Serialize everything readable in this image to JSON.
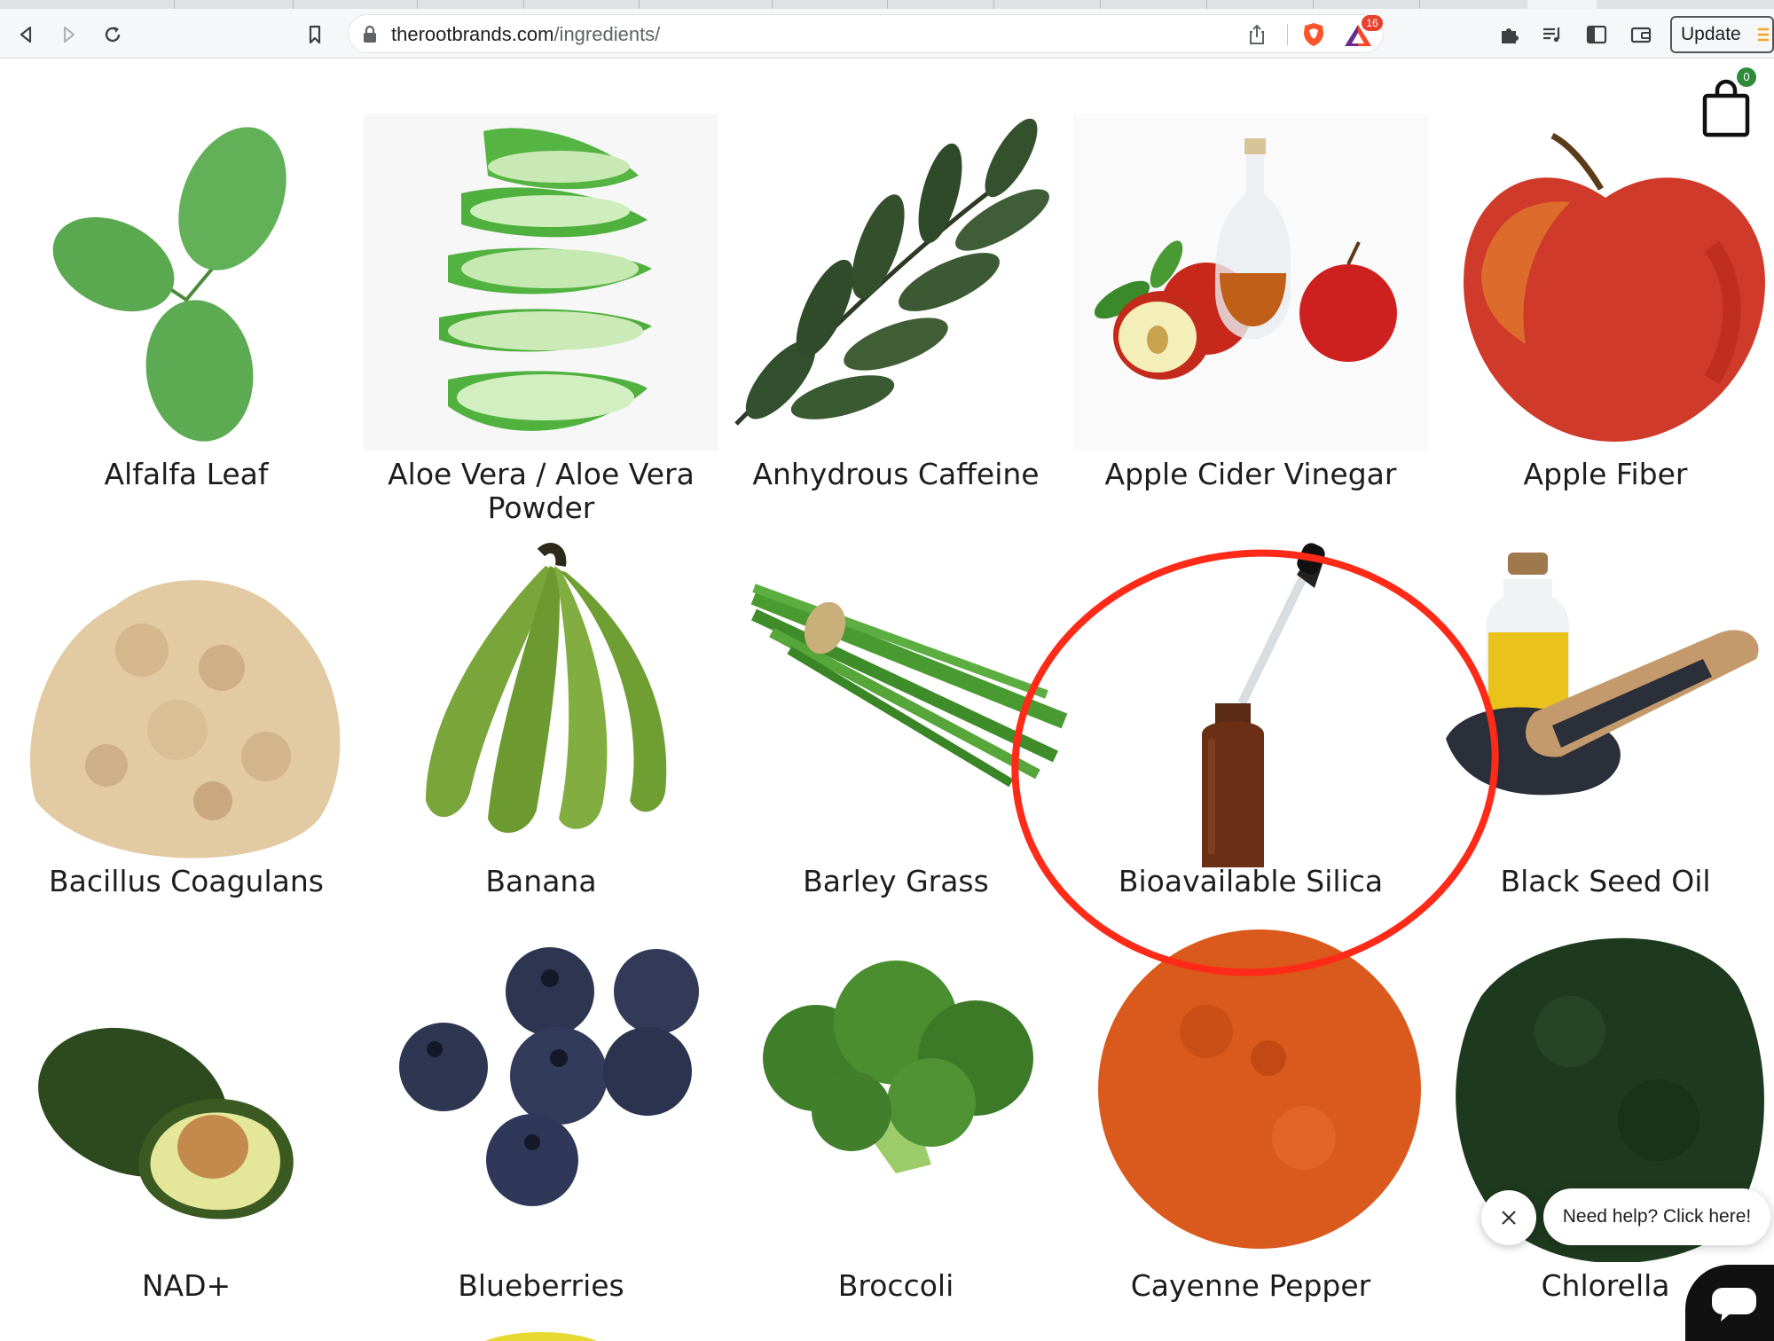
{
  "browser": {
    "url_host": "therootbrands.com",
    "url_path": "/ingredients/",
    "rewards_badge": "16",
    "update_label": "Update"
  },
  "cart": {
    "count": "0"
  },
  "ingredients": [
    {
      "label": "Alfalfa Leaf",
      "icon": "alfalfa-leaf-image"
    },
    {
      "label": "Aloe Vera / Aloe Vera",
      "label2": "Powder",
      "icon": "aloe-vera-image"
    },
    {
      "label": "Anhydrous Caffeine",
      "icon": "caffeine-leaves-image"
    },
    {
      "label": "Apple Cider Vinegar",
      "icon": "apple-cider-vinegar-image"
    },
    {
      "label": "Apple Fiber",
      "icon": "apple-image"
    },
    {
      "label": "Bacillus Coagulans",
      "icon": "powder-image"
    },
    {
      "label": "Banana",
      "icon": "banana-image"
    },
    {
      "label": "Barley Grass",
      "icon": "barley-grass-image"
    },
    {
      "label": "Bioavailable Silica",
      "icon": "dropper-bottle-image"
    },
    {
      "label": "Black Seed Oil",
      "icon": "black-seed-oil-image"
    },
    {
      "label": "NAD+",
      "icon": "avocado-image"
    },
    {
      "label": "Blueberries",
      "icon": "blueberries-image"
    },
    {
      "label": "Broccoli",
      "icon": "broccoli-image"
    },
    {
      "label": "Cayenne Pepper",
      "icon": "cayenne-powder-image"
    },
    {
      "label": "Chlorella",
      "icon": "chlorella-powder-image"
    }
  ],
  "annotation": {
    "color": "#ff2a17",
    "target": "Bioavailable Silica"
  },
  "chat": {
    "bubble_text": "Need help? Click here!"
  }
}
